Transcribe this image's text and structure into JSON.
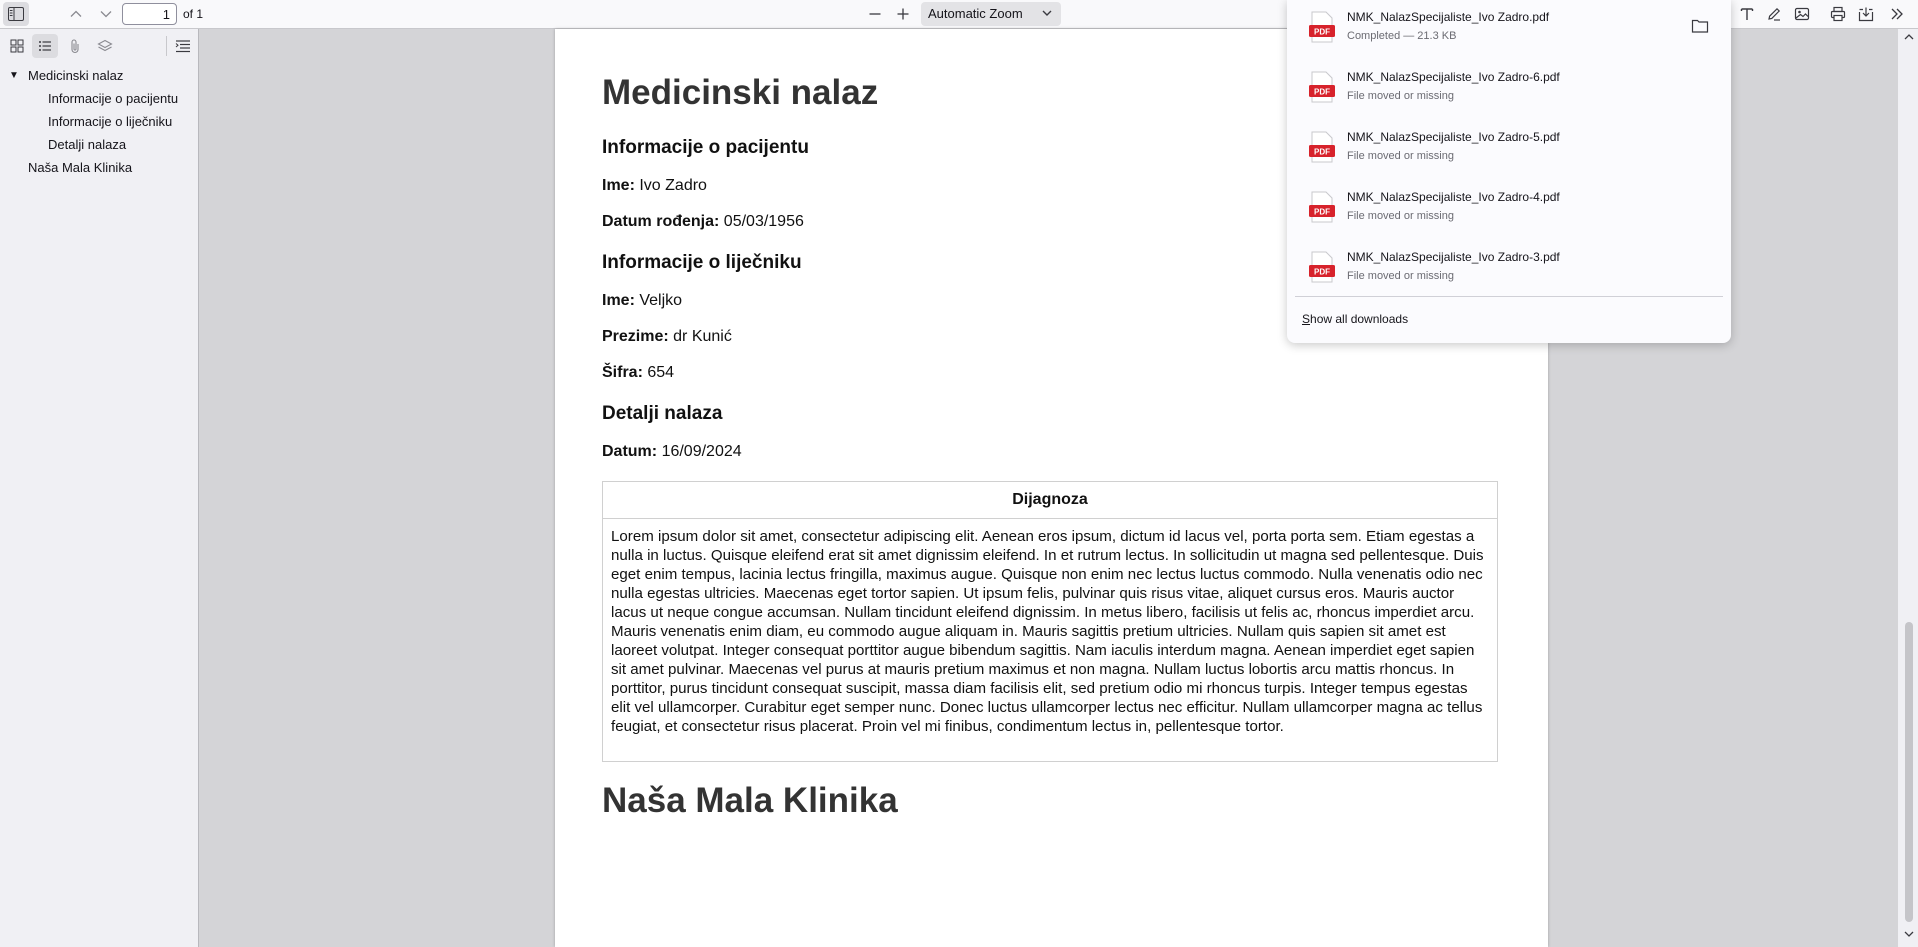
{
  "toolbar": {
    "page_number": "1",
    "page_count": "of 1",
    "zoom": "Automatic Zoom"
  },
  "outline": {
    "items": [
      {
        "label": "Medicinski nalaz",
        "expanded": true
      },
      {
        "label": "Informacije o pacijentu"
      },
      {
        "label": "Informacije o liječniku"
      },
      {
        "label": "Detalji nalaza"
      },
      {
        "label": "Naša Mala Klinika"
      }
    ]
  },
  "document": {
    "title": "Medicinski nalaz",
    "patient_heading": "Informacije o pacijentu",
    "patient_name_label": "Ime:",
    "patient_name": "Ivo Zadro",
    "dob_label": "Datum rođenja:",
    "dob": "05/03/1956",
    "doctor_heading": "Informacije o liječniku",
    "doctor_name_label": "Ime:",
    "doctor_name": "Veljko",
    "doctor_surname_label": "Prezime:",
    "doctor_surname": "dr Kunić",
    "code_label": "Šifra:",
    "code": "654",
    "details_heading": "Detalji nalaza",
    "date_label": "Datum:",
    "date": "16/09/2024",
    "diagnosis_header": "Dijagnoza",
    "diagnosis_text": "Lorem ipsum dolor sit amet, consectetur adipiscing elit. Aenean eros ipsum, dictum id lacus vel, porta porta sem. Etiam egestas a nulla in luctus. Quisque eleifend erat sit amet dignissim eleifend. In et rutrum lectus. In sollicitudin ut magna sed pellentesque. Duis eget enim tempus, lacinia lectus fringilla, maximus augue. Quisque non enim nec lectus luctus commodo. Nulla venenatis odio nec nulla egestas ultricies. Maecenas eget tortor sapien. Ut ipsum felis, pulvinar quis risus vitae, aliquet cursus eros. Mauris auctor lacus ut neque congue accumsan. Nullam tincidunt eleifend dignissim. In metus libero, facilisis ut felis ac, rhoncus imperdiet arcu. Mauris venenatis enim diam, eu commodo augue aliquam in. Mauris sagittis pretium ultricies. Nullam quis sapien sit amet est laoreet volutpat. Integer consequat porttitor augue bibendum sagittis. Nam iaculis interdum magna. Aenean imperdiet eget sapien sit amet pulvinar. Maecenas vel purus at mauris pretium maximus et non magna. Nullam luctus lobortis arcu mattis rhoncus. In porttitor, purus tincidunt consequat suscipit, massa diam facilisis elit, sed pretium odio mi rhoncus turpis. Integer tempus egestas elit vel ullamcorper. Curabitur eget semper nunc. Donec luctus ullamcorper lectus nec efficitur. Nullam ullamcorper magna ac tellus feugiat, et consectetur risus placerat. Proin vel mi finibus, condimentum lectus in, pellentesque tortor.",
    "footer_title": "Naša Mala Klinika"
  },
  "downloads": {
    "items": [
      {
        "name": "NMK_NalazSpecijaliste_Ivo Zadro.pdf",
        "status": "Completed — 21.3 KB"
      },
      {
        "name": "NMK_NalazSpecijaliste_Ivo Zadro-6.pdf",
        "status": "File moved or missing"
      },
      {
        "name": "NMK_NalazSpecijaliste_Ivo Zadro-5.pdf",
        "status": "File moved or missing"
      },
      {
        "name": "NMK_NalazSpecijaliste_Ivo Zadro-4.pdf",
        "status": "File moved or missing"
      },
      {
        "name": "NMK_NalazSpecijaliste_Ivo Zadro-3.pdf",
        "status": "File moved or missing"
      }
    ],
    "file_icon_label": "PDF",
    "show_all": "Show all downloads"
  },
  "colors": {
    "pdf_icon": "#d7222b",
    "accent": "#0060df"
  }
}
